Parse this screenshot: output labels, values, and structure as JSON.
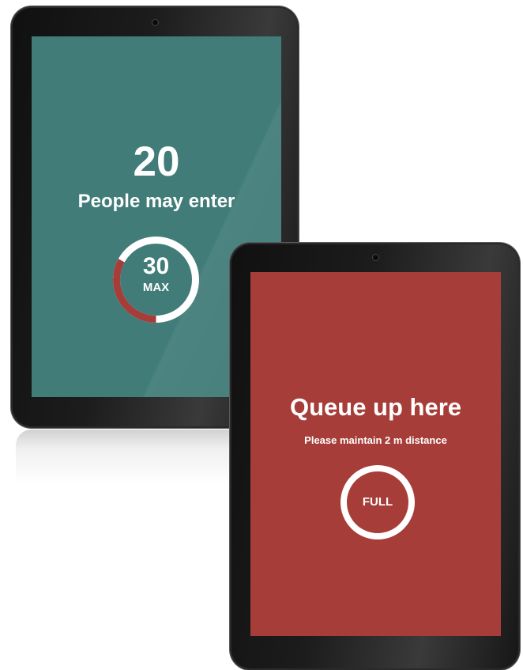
{
  "colors": {
    "teal_screen": "#417C79",
    "red_screen": "#A63D38",
    "ring_white": "#FFFFFF",
    "ring_red": "#A63D38"
  },
  "tablet_occupancy": {
    "count": "20",
    "message": "People may enter",
    "gauge": {
      "value": "30",
      "label": "MAX",
      "fill_fraction": 0.33
    }
  },
  "tablet_queue": {
    "title": "Queue up here",
    "subtitle": "Please maintain 2 m distance",
    "gauge": {
      "label": "FULL"
    }
  }
}
